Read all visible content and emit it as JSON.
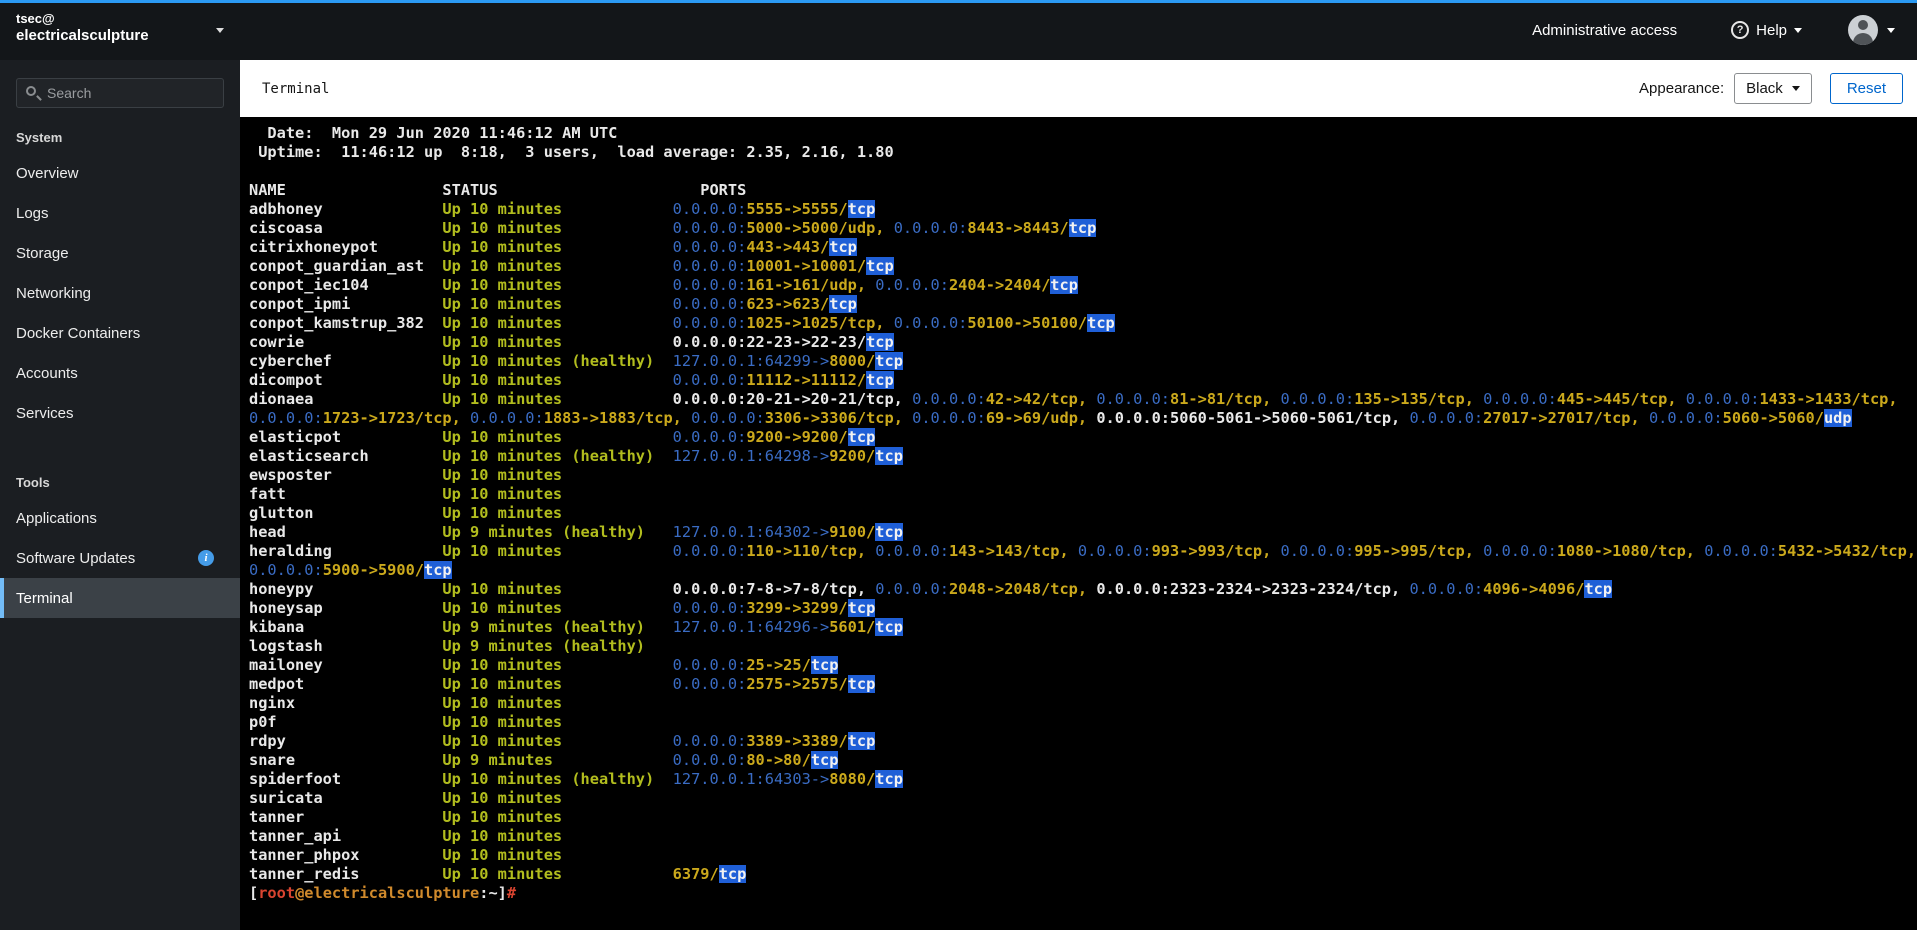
{
  "colors": {
    "accent": "#2b9af3",
    "term_white": "#e9e9e9",
    "term_status": "#b2bd1e",
    "term_port": "#cba91c",
    "term_ip": "#3a6cc4",
    "term_hl_bg": "#1f5fd7",
    "prompt_red": "#d94430",
    "prompt_orange": "#d08a2c"
  },
  "brand": {
    "user": "tsec@",
    "host": "electricalsculpture"
  },
  "search": {
    "placeholder": "Search"
  },
  "masthead": {
    "admin_access": "Administrative access",
    "help_label": "Help",
    "help_icon": "?"
  },
  "sidebar": {
    "sections": [
      {
        "title": "System",
        "items": [
          {
            "label": "Overview"
          },
          {
            "label": "Logs"
          },
          {
            "label": "Storage"
          },
          {
            "label": "Networking"
          },
          {
            "label": "Docker Containers"
          },
          {
            "label": "Accounts"
          },
          {
            "label": "Services"
          }
        ]
      },
      {
        "title": "Tools",
        "items": [
          {
            "label": "Applications"
          },
          {
            "label": "Software Updates",
            "info": true
          },
          {
            "label": "Terminal",
            "active": true
          }
        ]
      }
    ]
  },
  "toolbar": {
    "title": "Terminal",
    "appearance_label": "Appearance:",
    "appearance_value": "Black",
    "reset_label": "Reset"
  },
  "terminal": {
    "date_line": "  Date:  Mon 29 Jun 2020 11:46:12 AM UTC",
    "uptime_line": " Uptime:  11:46:12 up  8:18,  3 users,  load average: 2.35, 2.16, 1.80",
    "header": {
      "name": "NAME",
      "status": "STATUS",
      "ports": "PORTS"
    },
    "rows": [
      {
        "name": "adbhoney",
        "status": "Up 10 minutes",
        "ports": [
          [
            "b",
            "0.0.0.0:"
          ],
          [
            "y",
            "5555->5555/"
          ],
          [
            "h",
            "tcp"
          ]
        ]
      },
      {
        "name": "ciscoasa",
        "status": "Up 10 minutes",
        "ports": [
          [
            "b",
            "0.0.0.0:"
          ],
          [
            "y",
            "5000->5000/udp, "
          ],
          [
            "b",
            "0.0.0.0:"
          ],
          [
            "y",
            "8443->8443/"
          ],
          [
            "h",
            "tcp"
          ]
        ]
      },
      {
        "name": "citrixhoneypot",
        "status": "Up 10 minutes",
        "ports": [
          [
            "b",
            "0.0.0.0:"
          ],
          [
            "y",
            "443->443/"
          ],
          [
            "h",
            "tcp"
          ]
        ]
      },
      {
        "name": "conpot_guardian_ast",
        "status": "Up 10 minutes",
        "ports": [
          [
            "b",
            "0.0.0.0:"
          ],
          [
            "y",
            "10001->10001/"
          ],
          [
            "h",
            "tcp"
          ]
        ]
      },
      {
        "name": "conpot_iec104",
        "status": "Up 10 minutes",
        "ports": [
          [
            "b",
            "0.0.0.0:"
          ],
          [
            "y",
            "161->161/udp, "
          ],
          [
            "b",
            "0.0.0.0:"
          ],
          [
            "y",
            "2404->2404/"
          ],
          [
            "h",
            "tcp"
          ]
        ]
      },
      {
        "name": "conpot_ipmi",
        "status": "Up 10 minutes",
        "ports": [
          [
            "b",
            "0.0.0.0:"
          ],
          [
            "y",
            "623->623/"
          ],
          [
            "h",
            "tcp"
          ]
        ]
      },
      {
        "name": "conpot_kamstrup_382",
        "status": "Up 10 minutes",
        "ports": [
          [
            "b",
            "0.0.0.0:"
          ],
          [
            "y",
            "1025->1025/tcp, "
          ],
          [
            "b",
            "0.0.0.0:"
          ],
          [
            "y",
            "50100->50100/"
          ],
          [
            "h",
            "tcp"
          ]
        ]
      },
      {
        "name": "cowrie",
        "status": "Up 10 minutes",
        "ports": [
          [
            "w",
            "0.0.0.0:22-23->22-23/"
          ],
          [
            "h",
            "tcp"
          ]
        ]
      },
      {
        "name": "cyberchef",
        "status": "Up 10 minutes (healthy)",
        "ports": [
          [
            "b",
            "127.0.0.1:64299->"
          ],
          [
            "y",
            "8000/"
          ],
          [
            "h",
            "tcp"
          ]
        ]
      },
      {
        "name": "dicompot",
        "status": "Up 10 minutes",
        "ports": [
          [
            "b",
            "0.0.0.0:"
          ],
          [
            "y",
            "11112->11112/"
          ],
          [
            "h",
            "tcp"
          ]
        ]
      },
      {
        "name": "dionaea",
        "status": "Up 10 minutes",
        "ports": [
          [
            "w",
            "0.0.0.0:20-21->20-21/tcp, "
          ],
          [
            "b",
            "0.0.0.0:"
          ],
          [
            "y",
            "42->42/tcp, "
          ],
          [
            "b",
            "0.0.0.0:"
          ],
          [
            "y",
            "81->81/tcp, "
          ],
          [
            "b",
            "0.0.0.0:"
          ],
          [
            "y",
            "135->135/tcp, "
          ],
          [
            "b",
            "0.0.0.0:"
          ],
          [
            "y",
            "445->445/tcp, "
          ],
          [
            "b",
            "0.0.0.0:"
          ],
          [
            "y",
            "1433->1433/tcp, "
          ],
          [
            "b",
            "0.0.0.0:"
          ],
          [
            "y",
            "1723->1723/tcp, "
          ],
          [
            "b",
            "0.0.0.0:"
          ],
          [
            "y",
            "1883->1883/tcp, "
          ],
          [
            "b",
            "0.0.0.0:"
          ],
          [
            "y",
            "3306->3306/tcp, "
          ],
          [
            "b",
            "0.0.0.0:"
          ],
          [
            "y",
            "69->69/udp, "
          ],
          [
            "w",
            "0.0.0.0:5060-5061->5060-5061/tcp, "
          ],
          [
            "b",
            "0.0.0.0:"
          ],
          [
            "y",
            "27017->27017/tcp, "
          ],
          [
            "b",
            "0.0.0.0:"
          ],
          [
            "y",
            "5060->5060/"
          ],
          [
            "h",
            "udp"
          ]
        ]
      },
      {
        "name": "elasticpot",
        "status": "Up 10 minutes",
        "ports": [
          [
            "b",
            "0.0.0.0:"
          ],
          [
            "y",
            "9200->9200/"
          ],
          [
            "h",
            "tcp"
          ]
        ]
      },
      {
        "name": "elasticsearch",
        "status": "Up 10 minutes (healthy)",
        "ports": [
          [
            "b",
            "127.0.0.1:64298->"
          ],
          [
            "y",
            "9200/"
          ],
          [
            "h",
            "tcp"
          ]
        ]
      },
      {
        "name": "ewsposter",
        "status": "Up 10 minutes",
        "ports": []
      },
      {
        "name": "fatt",
        "status": "Up 10 minutes",
        "ports": []
      },
      {
        "name": "glutton",
        "status": "Up 10 minutes",
        "ports": []
      },
      {
        "name": "head",
        "status": "Up 9 minutes (healthy)",
        "ports": [
          [
            "b",
            "127.0.0.1:64302->"
          ],
          [
            "y",
            "9100/"
          ],
          [
            "h",
            "tcp"
          ]
        ]
      },
      {
        "name": "heralding",
        "status": "Up 10 minutes",
        "ports": [
          [
            "b",
            "0.0.0.0:"
          ],
          [
            "y",
            "110->110/tcp, "
          ],
          [
            "b",
            "0.0.0.0:"
          ],
          [
            "y",
            "143->143/tcp, "
          ],
          [
            "b",
            "0.0.0.0:"
          ],
          [
            "y",
            "993->993/tcp, "
          ],
          [
            "b",
            "0.0.0.0:"
          ],
          [
            "y",
            "995->995/tcp, "
          ],
          [
            "b",
            "0.0.0.0:"
          ],
          [
            "y",
            "1080->1080/tcp, "
          ],
          [
            "b",
            "0.0.0.0:"
          ],
          [
            "y",
            "5432->5432/tcp, "
          ],
          [
            "b",
            "0.0.0.0:"
          ],
          [
            "y",
            "5900->5900/"
          ],
          [
            "h",
            "tcp"
          ]
        ]
      },
      {
        "name": "honeypy",
        "status": "Up 10 minutes",
        "ports": [
          [
            "w",
            "0.0.0.0:7-8->7-8/tcp, "
          ],
          [
            "b",
            "0.0.0.0:"
          ],
          [
            "y",
            "2048->2048/tcp, "
          ],
          [
            "w",
            "0.0.0.0:2323-2324->2323-2324/tcp, "
          ],
          [
            "b",
            "0.0.0.0:"
          ],
          [
            "y",
            "4096->4096/"
          ],
          [
            "h",
            "tcp"
          ]
        ]
      },
      {
        "name": "honeysap",
        "status": "Up 10 minutes",
        "ports": [
          [
            "b",
            "0.0.0.0:"
          ],
          [
            "y",
            "3299->3299/"
          ],
          [
            "h",
            "tcp"
          ]
        ]
      },
      {
        "name": "kibana",
        "status": "Up 9 minutes (healthy)",
        "ports": [
          [
            "b",
            "127.0.0.1:64296->"
          ],
          [
            "y",
            "5601/"
          ],
          [
            "h",
            "tcp"
          ]
        ]
      },
      {
        "name": "logstash",
        "status": "Up 9 minutes (healthy)",
        "ports": []
      },
      {
        "name": "mailoney",
        "status": "Up 10 minutes",
        "ports": [
          [
            "b",
            "0.0.0.0:"
          ],
          [
            "y",
            "25->25/"
          ],
          [
            "h",
            "tcp"
          ]
        ]
      },
      {
        "name": "medpot",
        "status": "Up 10 minutes",
        "ports": [
          [
            "b",
            "0.0.0.0:"
          ],
          [
            "y",
            "2575->2575/"
          ],
          [
            "h",
            "tcp"
          ]
        ]
      },
      {
        "name": "nginx",
        "status": "Up 10 minutes",
        "ports": []
      },
      {
        "name": "p0f",
        "status": "Up 10 minutes",
        "ports": []
      },
      {
        "name": "rdpy",
        "status": "Up 10 minutes",
        "ports": [
          [
            "b",
            "0.0.0.0:"
          ],
          [
            "y",
            "3389->3389/"
          ],
          [
            "h",
            "tcp"
          ]
        ]
      },
      {
        "name": "snare",
        "status": "Up 9 minutes",
        "ports": [
          [
            "b",
            "0.0.0.0:"
          ],
          [
            "y",
            "80->80/"
          ],
          [
            "h",
            "tcp"
          ]
        ]
      },
      {
        "name": "spiderfoot",
        "status": "Up 10 minutes (healthy)",
        "ports": [
          [
            "b",
            "127.0.0.1:64303->"
          ],
          [
            "y",
            "8080/"
          ],
          [
            "h",
            "tcp"
          ]
        ]
      },
      {
        "name": "suricata",
        "status": "Up 10 minutes",
        "ports": []
      },
      {
        "name": "tanner",
        "status": "Up 10 minutes",
        "ports": []
      },
      {
        "name": "tanner_api",
        "status": "Up 10 minutes",
        "ports": []
      },
      {
        "name": "tanner_phpox",
        "status": "Up 10 minutes",
        "ports": []
      },
      {
        "name": "tanner_redis",
        "status": "Up 10 minutes",
        "ports": [
          [
            "y",
            "6379/"
          ],
          [
            "h",
            "tcp"
          ]
        ]
      }
    ],
    "prompt": [
      [
        "w",
        "["
      ],
      [
        "r",
        "root"
      ],
      [
        "o",
        "@electricalsculpture"
      ],
      [
        "w",
        ":~]"
      ],
      [
        "r",
        "#"
      ],
      [
        "w",
        " "
      ]
    ]
  }
}
